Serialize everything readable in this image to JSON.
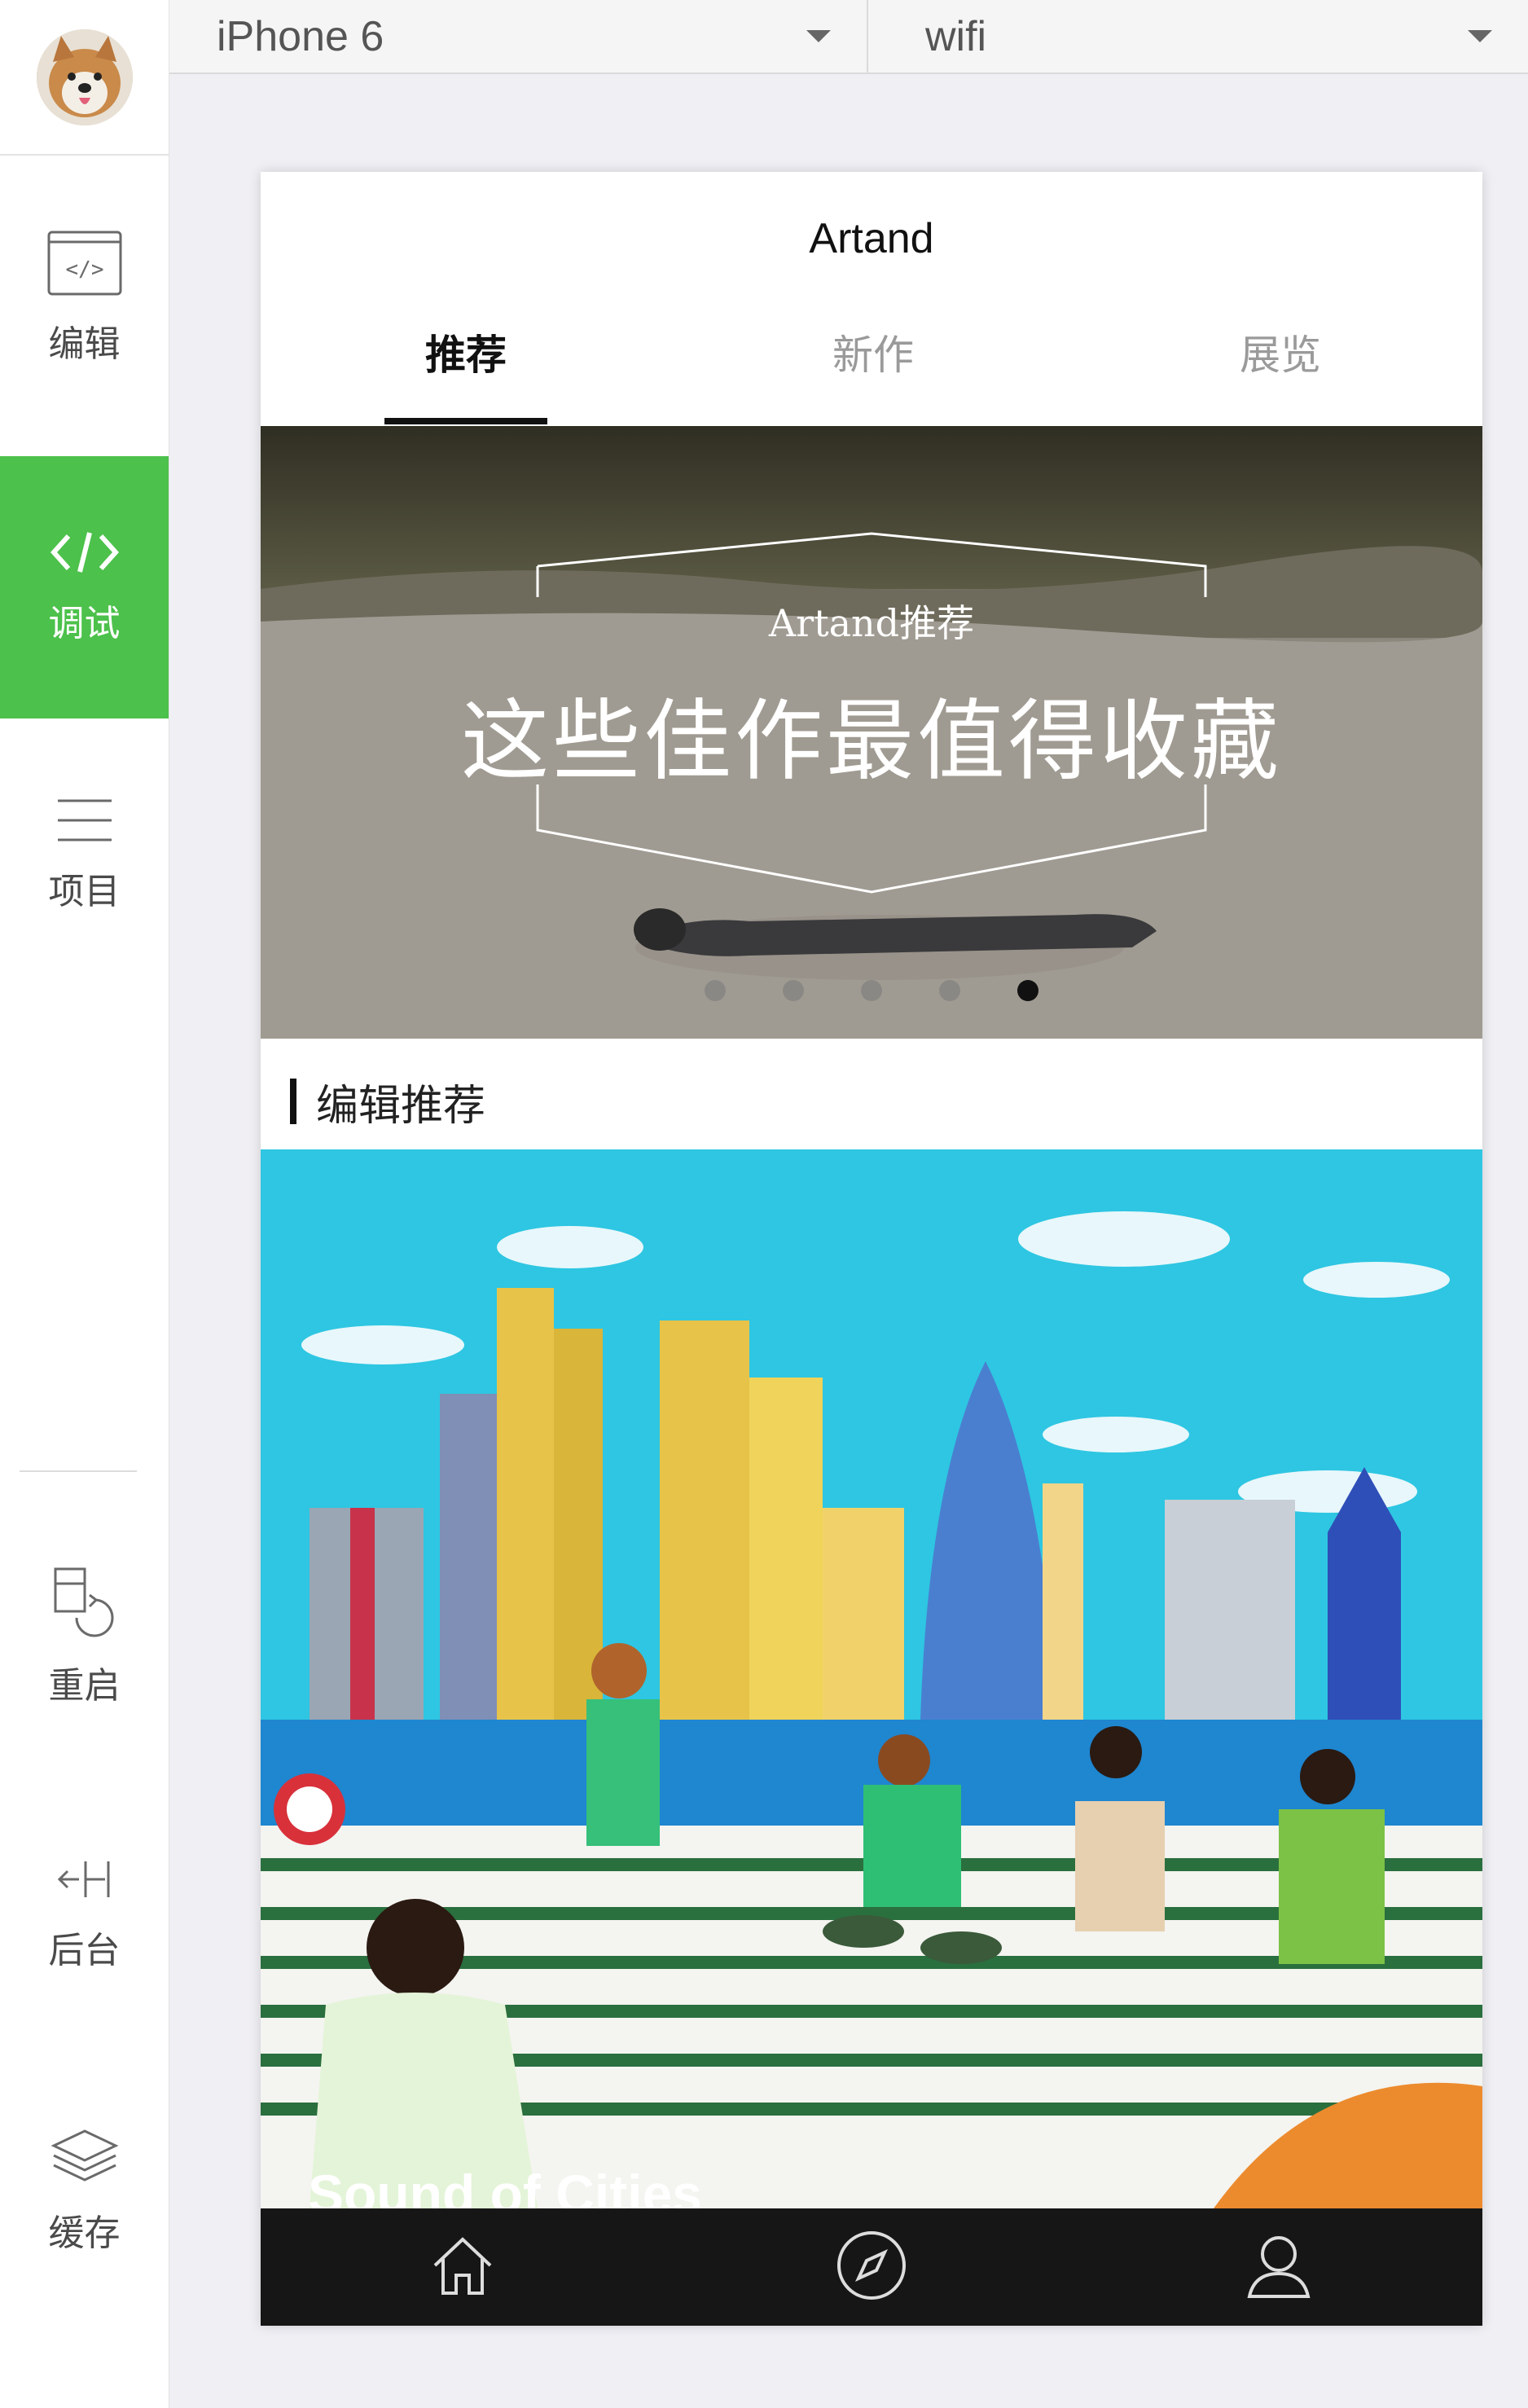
{
  "sidebar": {
    "avatar": "avatar-dog",
    "items": [
      {
        "icon": "code-file-icon",
        "label": "编辑"
      },
      {
        "icon": "code-brackets-icon",
        "label": "调试"
      },
      {
        "icon": "menu-icon",
        "label": "项目"
      },
      {
        "icon": "restart-icon",
        "label": "重启"
      },
      {
        "icon": "backend-icon",
        "label": "后台"
      },
      {
        "icon": "layers-icon",
        "label": "缓存"
      }
    ],
    "active_item": "调试",
    "active_color": "#4cc14b"
  },
  "toolbar": {
    "device": "iPhone 6",
    "network": "wifi"
  },
  "app": {
    "title": "Artand",
    "tabs": [
      "推荐",
      "新作",
      "展览"
    ],
    "active_tab": "推荐",
    "banner": {
      "subtitle": "Artand推荐",
      "title": "这些佳作最值得收藏",
      "slide_count": 5,
      "active_slide": 5
    },
    "section_title": "编辑推荐",
    "card_caption": "Sound of Cities",
    "bottom_nav": [
      "home-icon",
      "compass-icon",
      "user-icon"
    ]
  }
}
